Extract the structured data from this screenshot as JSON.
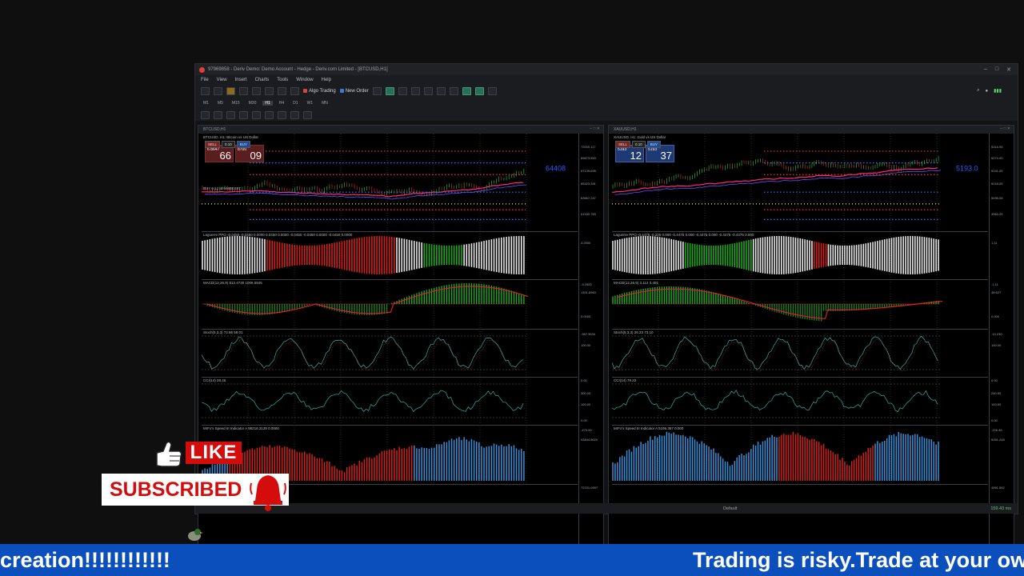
{
  "terminal": {
    "title": "97969858 - Deriv Demo: Demo Account - Hedge - Deriv.com Limited - [BTCUSD,H1]",
    "menu": [
      "File",
      "View",
      "Insert",
      "Charts",
      "Tools",
      "Window",
      "Help"
    ],
    "toolbar": {
      "algo_trading": "Algo Trading",
      "new_order": "New Order"
    },
    "timeframes": [
      "M1",
      "M5",
      "M15",
      "M30",
      "H1",
      "H4",
      "D1",
      "W1",
      "MN"
    ],
    "active_timeframe": "H1",
    "status": {
      "profile": "Default",
      "network": "159.43 ms"
    }
  },
  "charts": [
    {
      "window_title": "BTCUSD,H1",
      "symbol_label": "BTCUSD, H1:  Bitcoin vs US Dollar",
      "sell_label": "SELL",
      "buy_label": "BUY",
      "lot": "0.10",
      "bid_prefix": "6\n8647",
      "bid_big": "66",
      "bid_sup": "7",
      "ask_prefix": "8700",
      "ask_big": "09",
      "ask_sup": "3",
      "price_tag": "64408",
      "pane_labels": [
        "BUY 0.12 at 64688.597",
        "Laguerre PPO  -0.0450 -0.0450 0.0000 0.0450 0.0000 -0.0450 -0.0450 0.0000 -0.0450 0.0000",
        "MACD(12,26,9) 812.4730 1006.5845",
        "Stoch(5,3,3) 72.86 58.01",
        "CCI(14) 28.46",
        "MrFx's Speed III Indicator A 98218.3139 0.0000"
      ],
      "scale_ticks": [
        "72000.117",
        "69673.553",
        "67139.695",
        "65323.391",
        "63667.247",
        "61940.783",
        "3.2500",
        "-3.2500",
        "1301.8963",
        "0.0000",
        "-967.3634",
        "100.00",
        "0.00",
        "300.00",
        "100.00",
        "0.00",
        "-475.00",
        "93844.8020",
        "72231.0997"
      ],
      "x_labels": [
        "21 Feb 2026",
        "23 Feb 23:00",
        "24 Feb 07:00",
        "24 Feb 15:00",
        "24 Feb 23:00",
        "25 Feb 07:00",
        "25 Feb 15:00",
        "25 Feb 23:00"
      ]
    },
    {
      "window_title": "XAUUSD,H1",
      "symbol_label": "XAUUSD, H1:  Gold vs US Dollar",
      "sell_label": "SELL",
      "buy_label": "BUY",
      "lot": "0.10",
      "bid_prefix": "5193",
      "bid_big": "12",
      "bid_sup": "",
      "ask_prefix": "5193",
      "ask_big": "37",
      "ask_sup": "",
      "price_tag": "5193.0",
      "pane_labels": [
        "",
        "Laguerre PPO  -0.4475 -0.225 0.000 -0.4475 0.000 -0.4475 0.000 -0.4475 -0.4475 0.000",
        "MACD(12,26,9) 3.112  3.491",
        "Stoch(5,3,3) 26.23 73.10",
        "CCI(14) 79.22",
        "MrFx's Speed III Indicator A 5195.367 0.000"
      ],
      "scale_ticks": [
        "5316.95",
        "5274.00",
        "5241.05",
        "5218.05",
        "5095.05",
        "4963.25",
        "1.11",
        "-1.11",
        "46.627",
        "0.000",
        "-13.230",
        "100.00",
        "0.00",
        "250.00",
        "100.00",
        "0.00",
        "-226.46",
        "5261.248",
        "4961.582"
      ],
      "x_labels": [
        "20 Feb 2026",
        "20 Feb 20:00",
        "23 Feb 04:00",
        "23 Feb 12:00",
        "23 Feb 20:00",
        "24 Feb 04:00",
        "24 Feb 12:00",
        "24 Feb 20:00",
        "25 Feb 04:00",
        "25 Feb 12:00",
        "25 Feb 20:00"
      ]
    }
  ],
  "overlay": {
    "like": "LIKE",
    "subscribed": "SUBSCRIBED"
  },
  "ticker": {
    "left_text": "creation!!!!!!!!!!!!",
    "right_text": "Trading is risky.Trade at your ow"
  },
  "colors": {
    "bull": "#1fa81f",
    "bear": "#d0211c",
    "speed_bull": "#3b8fd6",
    "speed_bear": "#d0211c",
    "ticker_bg": "#0b4fbd",
    "like_red": "#d40c0c"
  }
}
